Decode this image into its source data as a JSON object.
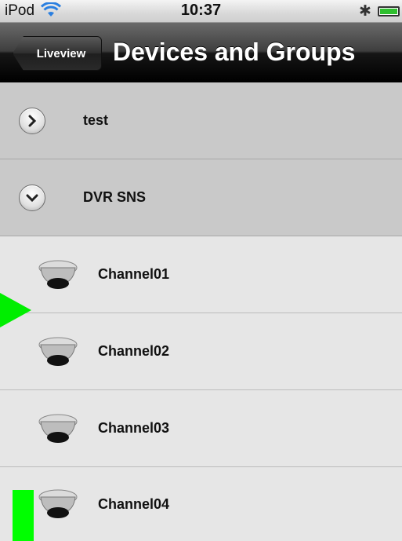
{
  "status_bar": {
    "carrier": "iPod",
    "time": "10:37",
    "wifi_icon": "wifi-icon",
    "bluetooth_icon": "bluetooth-icon",
    "battery_icon": "battery-icon"
  },
  "nav": {
    "back_label": "Liveview",
    "title": "Devices and Groups"
  },
  "groups": [
    {
      "label": "test",
      "expanded": false
    },
    {
      "label": "DVR SNS",
      "expanded": true
    }
  ],
  "channels": [
    {
      "label": "Channel01"
    },
    {
      "label": "Channel02"
    },
    {
      "label": "Channel03"
    },
    {
      "label": "Channel04"
    }
  ],
  "colors": {
    "marker": "#00ee00",
    "group_row": "#c9c9c9",
    "channel_row": "#e6e6e6"
  }
}
